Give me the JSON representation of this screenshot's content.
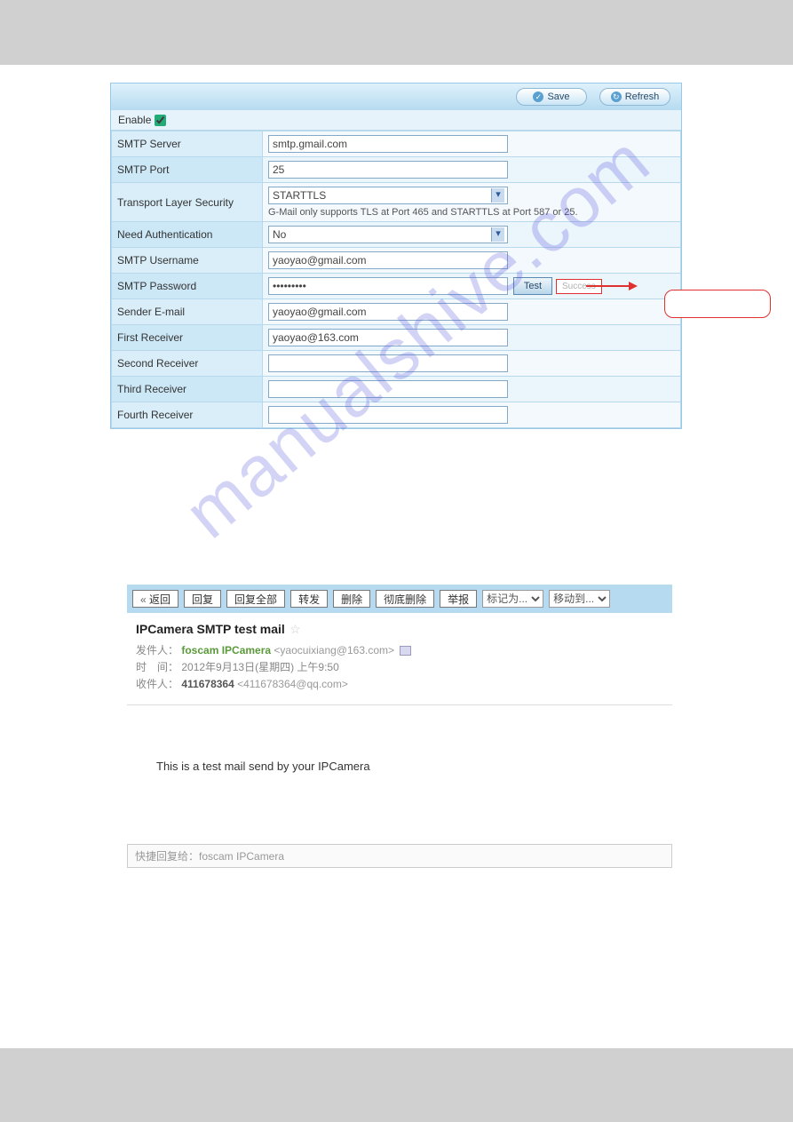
{
  "header": {
    "save": "Save",
    "refresh": "Refresh"
  },
  "enable_label": "Enable",
  "enable_checked": true,
  "fields": {
    "smtp_server": {
      "label": "SMTP Server",
      "value": "smtp.gmail.com"
    },
    "smtp_port": {
      "label": "SMTP Port",
      "value": "25"
    },
    "tls": {
      "label": "Transport Layer Security",
      "value": "STARTTLS",
      "hint": "G-Mail only supports TLS at Port 465 and STARTTLS at Port 587 or 25."
    },
    "need_auth": {
      "label": "Need Authentication",
      "value": "No"
    },
    "username": {
      "label": "SMTP Username",
      "value": "yaoyao@gmail.com"
    },
    "password": {
      "label": "SMTP Password",
      "value": "•••••••••",
      "test": "Test",
      "result": "Success"
    },
    "sender": {
      "label": "Sender E-mail",
      "value": "yaoyao@gmail.com"
    },
    "r1": {
      "label": "First Receiver",
      "value": "yaoyao@163.com"
    },
    "r2": {
      "label": "Second Receiver",
      "value": ""
    },
    "r3": {
      "label": "Third Receiver",
      "value": ""
    },
    "r4": {
      "label": "Fourth Receiver",
      "value": ""
    }
  },
  "mail": {
    "buttons": {
      "back": "返回",
      "reply": "回复",
      "reply_all": "回复全部",
      "forward": "转发",
      "delete": "删除",
      "delete_all": "彻底删除",
      "report": "举报"
    },
    "selects": {
      "mark": "标记为...",
      "move": "移动到..."
    },
    "subject": "IPCamera SMTP test mail",
    "from_label": "发件人：",
    "from_name": "foscam IPCamera",
    "from_email": "<yaocuixiang@163.com>",
    "date_label": "时　间：",
    "date_value": "2012年9月13日(星期四) 上午9:50",
    "to_label": "收件人：",
    "to_name": "411678364",
    "to_email": "<411678364@qq.com>",
    "body": "This is a test mail send by your IPCamera",
    "quickreply": "快捷回复给：foscam IPCamera"
  }
}
